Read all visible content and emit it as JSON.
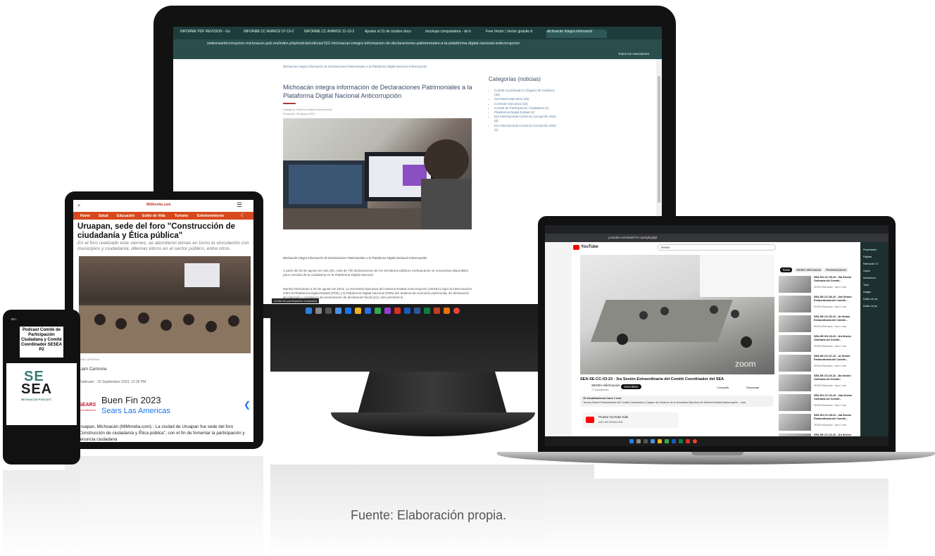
{
  "caption": "Fuente: Elaboración propia.",
  "monitor": {
    "tabs": [
      "INFORME PDF REVISIÓN - Go",
      "INFORME CC AVANCE 07-19-2",
      "INFORME CC AVANCE 31-10-2",
      "Ajustes al 31 de octubre docu",
      "mockups computadora - de b",
      "Free Vector | Vector gratuito d",
      "Michoacán integra informació"
    ],
    "url": "sistemaanticorrupcion.michoacan.gob.mx/index.php/noticia/noticias/152-michoacan-integra-informacion-de-declaraciones-patrimoniales-a-la-plataforma-digital-nacional-anticorrupcion",
    "bookmarks": "Todos los marcadores",
    "breadcrumb": "Michoacán integra información de Declaraciones Patrimoniales a la Plataforma Digital Nacional Anticorrupción",
    "article_title": "Michoacán integra información de Declaraciones Patrimoniales a la Plataforma Digital Nacional Anticorrupción",
    "category_meta": "Categoría: Sistema Estatal Anticorrupción",
    "published_meta": "Publicado: 03 Agosto 2023",
    "photo_caption": "Michoacán integra información de Declaraciones Patrimoniales a la Plataforma Digital Nacional Anticorrupción",
    "paragraph1": "A partir del 02 de agosto de este año, más de 700 declaraciones de los servidores públicos michoacanos se encuentran disponibles para consulta de la ciudadanía en la Plataforma Digital Nacional",
    "paragraph2": "Morelia Michoacán a 03 de agosto de 2023; La Secretaría Ejecutiva del Sistema Estatal Anticorrupción (SESEA) logró la interconexión entre la Plataforma Digital Estatal (PDE) y la Plataforma Digital Nacional (PDN) del Sistema de evolución patrimonial, de declaración de intereses y constancia de presentación de declaración fiscal (S1), esto permitirá la",
    "categories_title": "Categorías (noticias)",
    "categories": [
      "Comité Coordinador y Órgano de Gobierno (34)",
      "Secretaría Ejecutiva (25)",
      "Comisión Ejecutiva (15)",
      "Comité de Participación Ciudadana (1)",
      "Plataforma Digital Estatal (2)",
      "Día Internacional Contra la Corrupción 2021 (6)",
      "Día Internacional Contra la Corrupción 2022 (1)"
    ],
    "status_link": "comite-de-participacion-ciudadana"
  },
  "laptop": {
    "url": "youtube.com/watch?v=sp4Q5ydg8",
    "search_value": "sesea",
    "video_title": "SEA-SE-CC-03-23 - 3ra Sesión Extraordinaria del Comité Coordinador del SEA",
    "channel": "SESEA Michoacán",
    "subs": "71 suscriptores",
    "subscribe": "Suscribirse",
    "share": "Compartir",
    "download": "Descargar",
    "views": "10 visualizaciones  hace 1 mes",
    "description": "Tercera Sesión Extraordinaria del Comité Coordinador y Órgano de Gobierno de la Secretaría Ejecutiva del Sistema Estatal Anticorrupción ...más",
    "kids_title": "Prueba YouTube Kids",
    "kids_sub": "MÁS INFORMACIÓN",
    "chips": [
      "Todos",
      "SESEA Michoacán",
      "Presentaciones"
    ],
    "related": [
      {
        "title": "SEA-SO-CC-05-23 - 5ta Sesión Ordinaria del Comité...",
        "meta": "SESEA Michoacán · hace 1 mes"
      },
      {
        "title": "SEA-SE-CC-08-23 - 2da Sesión Extraordinaria del Comité...",
        "meta": "SESEA Michoacán · hace 1 mes"
      },
      {
        "title": "SEA-SE-CC-09-23 - 3a Sesión Extraordinaria del Comité...",
        "meta": "SESEA Michoacán · hace 1 mes"
      },
      {
        "title": "SEA-SE-SO-03-23 - 3ra Sesión Ordinaria del Comité...",
        "meta": "SESEA Michoacán · hace 1 mes"
      },
      {
        "title": "SEA-SE-CC-07-23 - 1a Sesión Extraordinaria del Comité...",
        "meta": "SESEA Michoacán · hace 1 mes"
      },
      {
        "title": "SEA-SE-CC-04-22 - 4ta Sesión Ordinaria del Comité...",
        "meta": "SESEA Michoacán · hace 1 mes"
      },
      {
        "title": "SEA-SO-CC-02-23 - 2da Sesión Ordinaria del Comité...",
        "meta": "SESEA Michoacán · hace 1 mes"
      },
      {
        "title": "SEA-SO-CC-05-22 - 4ta Sesión Extraordinaria del Comité...",
        "meta": "SESEA Michoacán · hace 1 mes"
      },
      {
        "title": "SEA-SE-CC-03-23 - 3ra Sesión Ordinaria del Comité...",
        "meta": "SESEA Michoacán · hace 1 mes"
      }
    ],
    "right_panel": [
      "Propiedades",
      "Páginas",
      "Michoacán 12",
      "Capas",
      "Marcadores",
      "Texto",
      "Imagen",
      "Estilos de car.",
      "Estilos de pá."
    ]
  },
  "tablet": {
    "brand": "MiMorelia.com",
    "nav": [
      "Home",
      "Salud",
      "Educación",
      "Estilo de Vida",
      "Turismo",
      "Entretenimiento"
    ],
    "title": "Uruapan, sede del foro \"Construcción de ciudadanía y Ética pública\"",
    "subtitle": "En el foro realizado este viernes, se abordaron temas en torno la vinculación con municipios y ciudadanía; dilemas éticos en el sector público, entre otros",
    "photo_credit": "LIAM CARMONA",
    "author": "Liam Carmona",
    "date": "Publicado : 22 Septiembre 2023, 12:39 PM",
    "ad_brand": "SEARS",
    "ad_brand_small": "Da la diferencia",
    "ad_title": "Buen Fin 2023",
    "ad_subtitle": "Sears Las Americas",
    "body": "Uruapan, Michoacán (MiMorelia.com).- La ciudad de Uruapan fue sede del foro \"Construcción de ciudadanía y Ética pública\", con el fin de fomentar la participación y denuncia ciudadana"
  },
  "phone": {
    "status": "Bm.",
    "card_text": "Podcast Comité de Participación Ciudadana y Comité Coordinador SESEA P2",
    "logo_se": "SE",
    "logo_sea": "SEA",
    "logo_sub": "MICHOACÁN PODCAST"
  },
  "colors": {
    "accent_orange": "#d6491c",
    "teal": "#3a7a74",
    "yt_red": "#ff0000"
  }
}
